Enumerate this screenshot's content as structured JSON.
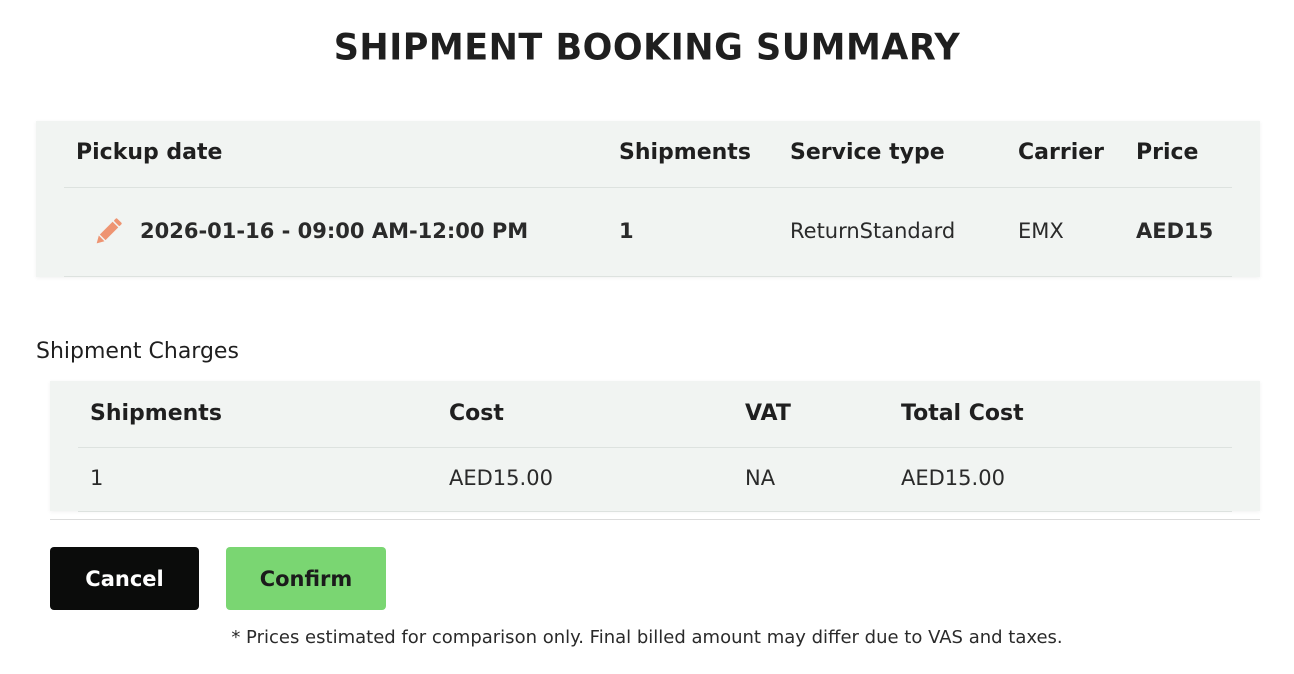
{
  "title": "SHIPMENT BOOKING SUMMARY",
  "summary": {
    "headers": {
      "pickup_date": "Pickup date",
      "shipments": "Shipments",
      "service_type": "Service type",
      "carrier": "Carrier",
      "price": "Price"
    },
    "row": {
      "pickup_date": "2026-01-16 - 09:00 AM-12:00 PM",
      "shipments": "1",
      "service_type": "ReturnStandard",
      "carrier": "EMX",
      "price": "AED15"
    },
    "edit_icon": "pencil-icon"
  },
  "charges": {
    "label": "Shipment Charges",
    "headers": {
      "shipments": "Shipments",
      "cost": "Cost",
      "vat": "VAT",
      "total_cost": "Total Cost"
    },
    "row": {
      "shipments": "1",
      "cost": "AED15.00",
      "vat": "NA",
      "total_cost": "AED15.00"
    }
  },
  "actions": {
    "cancel_label": "Cancel",
    "confirm_label": "Confirm"
  },
  "footnote": "* Prices estimated for comparison only. Final billed amount may differ due to VAS and taxes.",
  "colors": {
    "confirm_button": "#7ad672",
    "cancel_button": "#0b0c0b",
    "edit_icon": "#ee9472",
    "panel_background": "#f1f4f2"
  }
}
